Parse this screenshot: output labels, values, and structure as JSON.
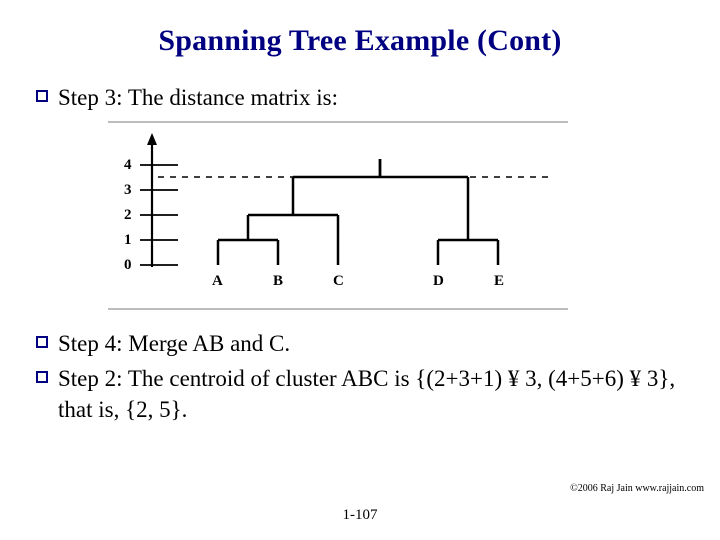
{
  "title": "Spanning Tree Example (Cont)",
  "bullets": {
    "b1": "Step 3: The distance matrix is:",
    "b2": "Step 4: Merge AB and C.",
    "b3": "Step 2: The centroid of cluster ABC is {(2+3+1) ¥ 3, (4+5+6) ¥ 3}, that is, {2, 5}."
  },
  "chart_data": {
    "type": "dendrogram",
    "title": "",
    "xlabel": "",
    "ylabel": "",
    "ylim": [
      0,
      4.2
    ],
    "yticks": [
      0,
      1,
      2,
      3,
      4
    ],
    "leaves": [
      "A",
      "B",
      "C",
      "D",
      "E"
    ],
    "merges": [
      {
        "members": [
          "A",
          "B"
        ],
        "height": 1
      },
      {
        "members": [
          "D",
          "E"
        ],
        "height": 1
      },
      {
        "members": [
          "A",
          "B",
          "C"
        ],
        "height": 2
      },
      {
        "members": [
          "A",
          "B",
          "C",
          "D",
          "E"
        ],
        "height": 3.5
      }
    ]
  },
  "page": "1-107",
  "copyright": "©2006 Raj Jain www.rajjain.com"
}
